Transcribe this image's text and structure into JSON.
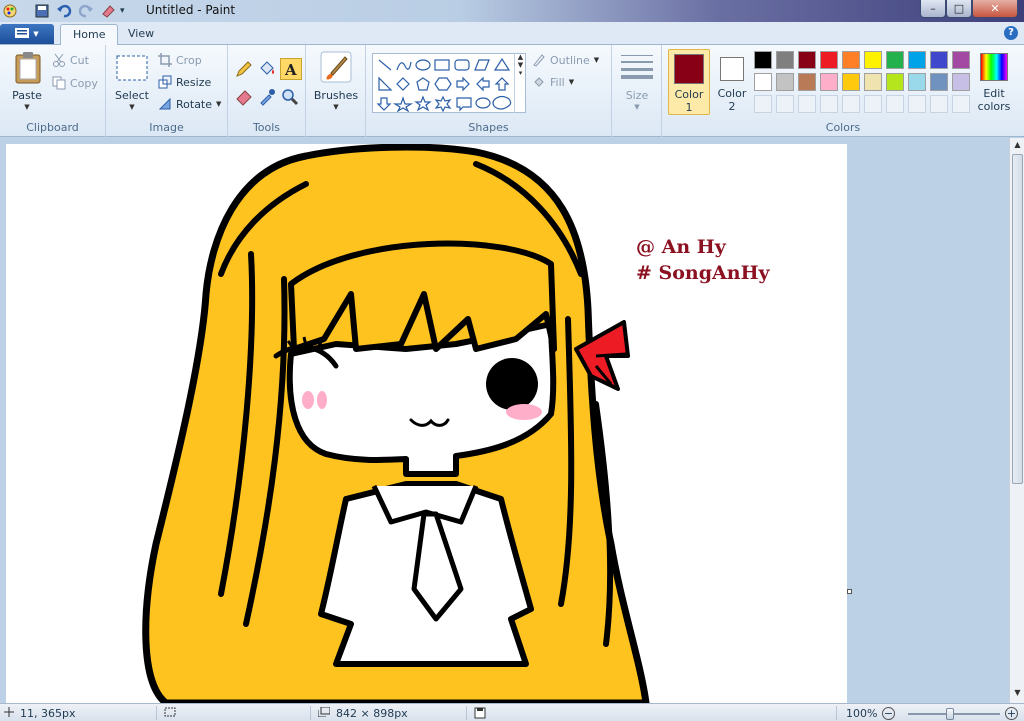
{
  "window": {
    "title": "Untitled - Paint",
    "buttons": {
      "minimize": "–",
      "maximize": "□",
      "close": "✕"
    }
  },
  "tabs": {
    "menu_icon": "app-menu-icon",
    "home": "Home",
    "view": "View",
    "help": "?"
  },
  "ribbon": {
    "clipboard": {
      "label": "Clipboard",
      "paste": "Paste",
      "cut": "Cut",
      "copy": "Copy"
    },
    "image": {
      "label": "Image",
      "select": "Select",
      "crop": "Crop",
      "resize": "Resize",
      "rotate": "Rotate"
    },
    "tools": {
      "label": "Tools"
    },
    "brushes": {
      "label": "Brushes"
    },
    "shapes": {
      "label": "Shapes",
      "outline": "Outline",
      "fill": "Fill"
    },
    "size": {
      "label": "Size"
    },
    "colors": {
      "label": "Colors",
      "color1": "Color 1",
      "color1_line1": "Color",
      "color1_line2": "1",
      "color2_line1": "Color",
      "color2_line2": "2",
      "color1_value": "#880015",
      "color2_value": "#ffffff",
      "edit_line1": "Edit",
      "edit_line2": "colors",
      "palette_row1": [
        "#000000",
        "#7f7f7f",
        "#880015",
        "#ed1c24",
        "#ff7f27",
        "#fff200",
        "#22b14c",
        "#00a2e8",
        "#3f48cc",
        "#a349a4"
      ],
      "palette_row2": [
        "#ffffff",
        "#c3c3c3",
        "#b97a57",
        "#ffaec9",
        "#ffc90e",
        "#efe4b0",
        "#b5e61d",
        "#99d9ea",
        "#7092be",
        "#c8bfe7"
      ]
    }
  },
  "canvas": {
    "signature_line1": "@ An Hy",
    "signature_line2": "# SongAnHy",
    "drawing_colors": {
      "hair": "#ffc31f",
      "outline": "#000000",
      "ribbon": "#ed1c24",
      "blush": "#ffaec9"
    }
  },
  "status": {
    "cursor": "11, 365px",
    "dimensions": "842 × 898px",
    "zoom": "100%"
  }
}
